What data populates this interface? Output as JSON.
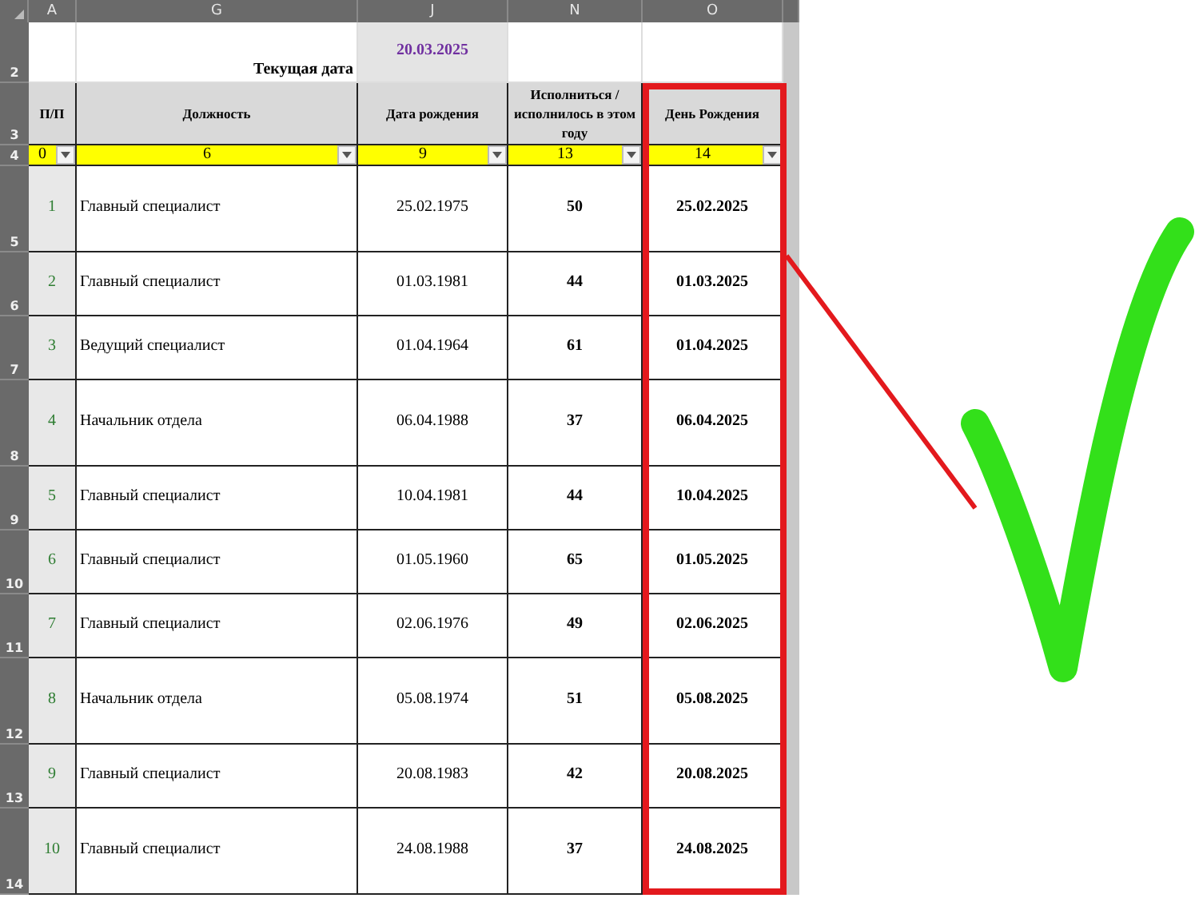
{
  "column_headers": [
    "A",
    "G",
    "J",
    "N",
    "O"
  ],
  "date_row": {
    "row_number": "2",
    "label": "Текущая дата",
    "value": "20.03.2025"
  },
  "header_row": {
    "row_number": "3",
    "columns": [
      "П/П",
      "Должность",
      "Дата рождения",
      "Исполниться / исполнилось в этом году",
      "День Рождения"
    ]
  },
  "filter_row": {
    "row_number": "4",
    "values": [
      "0",
      "6",
      "9",
      "13",
      "14"
    ]
  },
  "rows": [
    {
      "row_number": "5",
      "index": "1",
      "position": "Главный специалист",
      "birth_date": "25.02.1975",
      "age": "50",
      "birthday": "25.02.2025"
    },
    {
      "row_number": "6",
      "index": "2",
      "position": "Главный специалист",
      "birth_date": "01.03.1981",
      "age": "44",
      "birthday": "01.03.2025"
    },
    {
      "row_number": "7",
      "index": "3",
      "position": "Ведущий специалист",
      "birth_date": "01.04.1964",
      "age": "61",
      "birthday": "01.04.2025"
    },
    {
      "row_number": "8",
      "index": "4",
      "position": "Начальник отдела",
      "birth_date": "06.04.1988",
      "age": "37",
      "birthday": "06.04.2025"
    },
    {
      "row_number": "9",
      "index": "5",
      "position": "Главный специалист",
      "birth_date": "10.04.1981",
      "age": "44",
      "birthday": "10.04.2025"
    },
    {
      "row_number": "10",
      "index": "6",
      "position": "Главный специалист",
      "birth_date": "01.05.1960",
      "age": "65",
      "birthday": "01.05.2025"
    },
    {
      "row_number": "11",
      "index": "7",
      "position": "Главный специалист",
      "birth_date": "02.06.1976",
      "age": "49",
      "birthday": "02.06.2025"
    },
    {
      "row_number": "12",
      "index": "8",
      "position": "Начальник отдела",
      "birth_date": "05.08.1974",
      "age": "51",
      "birthday": "05.08.2025"
    },
    {
      "row_number": "13",
      "index": "9",
      "position": "Главный специалист",
      "birth_date": "20.08.1983",
      "age": "42",
      "birthday": "20.08.2025"
    },
    {
      "row_number": "14",
      "index": "10",
      "position": "Главный специалист",
      "birth_date": "24.08.1988",
      "age": "37",
      "birthday": "24.08.2025"
    }
  ]
}
